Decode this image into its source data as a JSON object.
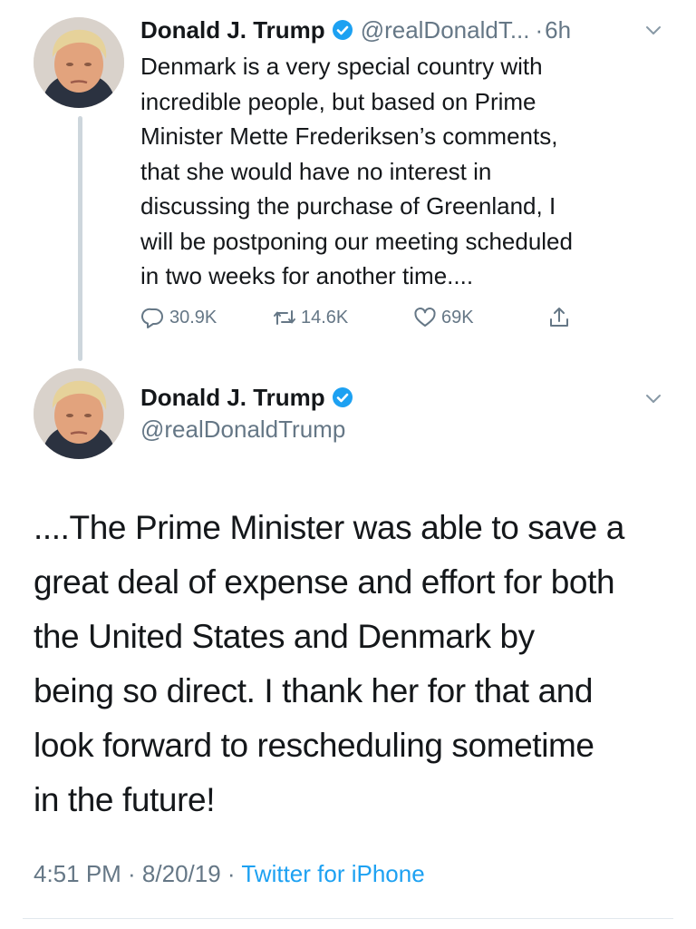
{
  "thread": {
    "tweets": [
      {
        "author_name": "Donald J. Trump",
        "handle": "@realDonaldT...",
        "separator": "·",
        "time": "6h",
        "lines": [
          "Denmark is a very special country with",
          "incredible people, but based on Prime",
          "Minister Mette Frederiksen’s comments,",
          "that she would have no interest in",
          "discussing the purchase of Greenland, I",
          "will be postponing our meeting scheduled",
          "in two weeks for another time...."
        ],
        "stats": {
          "replies": "30.9K",
          "retweets": "14.6K",
          "likes": "69K"
        },
        "icons": {
          "reply": "comment-icon",
          "retweet": "retweet-icon",
          "like": "heart-icon",
          "share": "share-icon",
          "verified": "verified-badge-icon",
          "menu": "chevron-down-icon"
        }
      },
      {
        "author_name": "Donald J. Trump",
        "handle": "@realDonaldTrump",
        "lines": [
          "....The Prime Minister was able to save a",
          "great deal of expense and effort for both",
          "the United States and Denmark by",
          "being so direct. I thank her for that and",
          "look forward to rescheduling sometime",
          "in the future!"
        ],
        "timestamp": "4:51 PM · 8/20/19",
        "meta_separator": "·",
        "source": "Twitter for iPhone"
      }
    ]
  },
  "colors": {
    "text_primary": "#14171a",
    "text_secondary": "#657786",
    "accent": "#1da1f2",
    "thread_line": "#cdd6dc"
  }
}
